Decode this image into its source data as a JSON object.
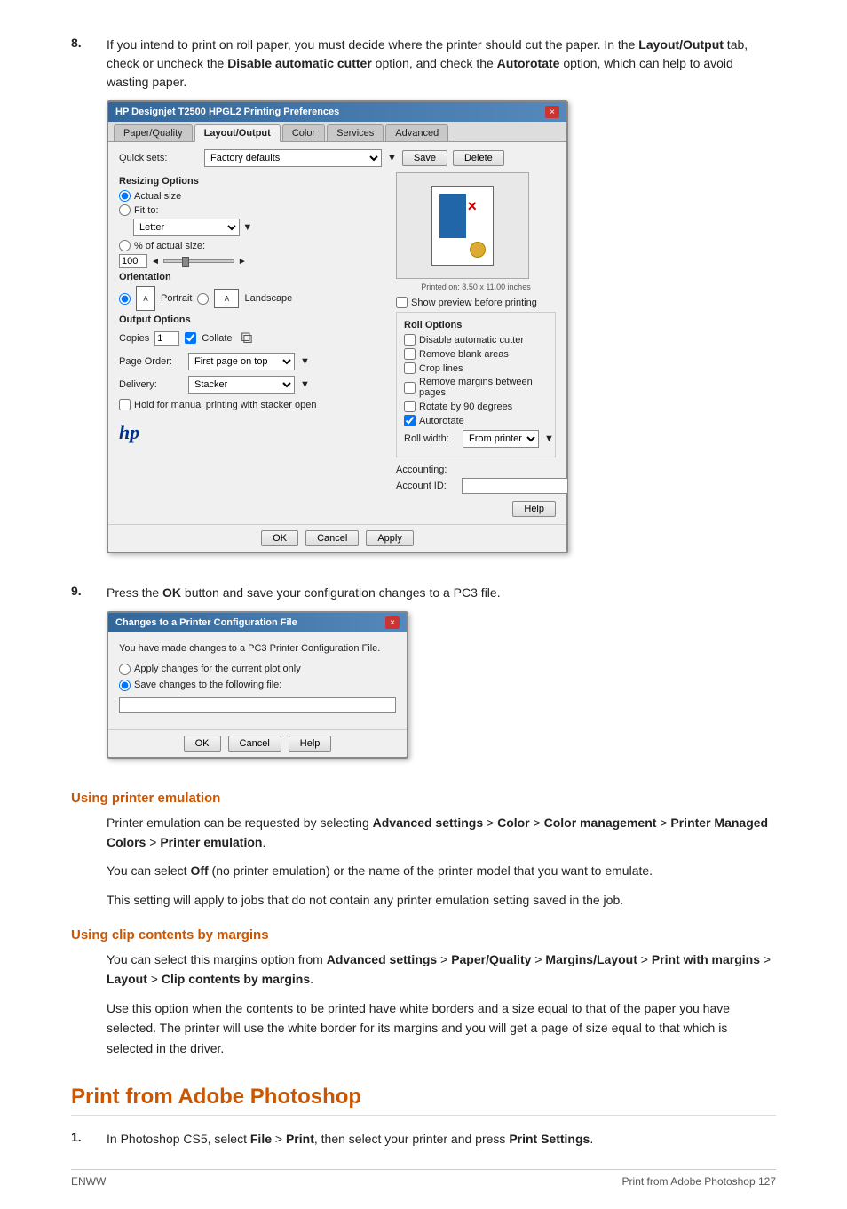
{
  "page": {
    "footer_left": "ENWW",
    "footer_right": "Print from Adobe Photoshop   127"
  },
  "step8": {
    "number": "8.",
    "text_intro": "If you intend to print on roll paper, you must decide where the printer should cut the paper. In the ",
    "bold1": "Layout/Output",
    "text_mid": " tab, check or uncheck the ",
    "bold2": "Disable automatic cutter",
    "text_mid2": " option, and check the ",
    "bold3": "Autorotate",
    "text_end": " option, which can help to avoid wasting paper."
  },
  "dialog1": {
    "title": "HP Designjet T2500 HPGL2 Printing Preferences",
    "close_btn": "×",
    "tabs": [
      "Paper/Quality",
      "Layout/Output",
      "Color",
      "Services",
      "Advanced"
    ],
    "active_tab": "Layout/Output",
    "quick_sets_label": "Quick sets:",
    "factory_defaults": "Factory defaults",
    "save_btn": "Save",
    "delete_btn": "Delete",
    "resizing_options": "Resizing Options",
    "actual_size": "Actual size",
    "fit_to": "Fit to:",
    "fit_to_value": "Letter",
    "pct_actual": "% of actual size:",
    "pct_value": "100",
    "orientation_label": "Orientation",
    "portrait": "Portrait",
    "landscape": "Landscape",
    "output_options": "Output Options",
    "copies_label": "Copies",
    "copies_value": "1",
    "collate": "Collate",
    "page_order_label": "Page Order:",
    "page_order_value": "First page on top",
    "delivery_label": "Delivery:",
    "delivery_value": "Stacker",
    "hold_label": "Hold for manual printing with stacker open",
    "hp_logo": "hp",
    "help_btn": "Help",
    "ok_btn": "OK",
    "cancel_btn": "Cancel",
    "apply_btn": "Apply",
    "preview_text": "Printed on: 8.50 x 11.00 inches",
    "show_preview": "Show preview before printing",
    "roll_options_label": "Roll Options",
    "disable_auto_cutter": "Disable automatic cutter",
    "remove_blank_areas": "Remove blank areas",
    "crop_lines": "Crop lines",
    "remove_margins": "Remove margins between pages",
    "rotate_90": "Rotate by 90 degrees",
    "autorotate": "Autorotate",
    "roll_width_label": "Roll width:",
    "roll_width_value": "From printer",
    "accounting_label": "Accounting:",
    "account_id_label": "Account ID:"
  },
  "step9": {
    "number": "9.",
    "text": "Press the ",
    "bold_ok": "OK",
    "text2": " button and save your configuration changes to a PC3 file."
  },
  "dialog2": {
    "title": "Changes to a Printer Configuration File",
    "close_btn": "×",
    "body_text": "You have made changes to a PC3 Printer Configuration File.",
    "radio1": "Apply changes for the current plot only",
    "radio2": "Save changes to the following file:",
    "ok_btn": "OK",
    "cancel_btn": "Cancel",
    "help_btn": "Help"
  },
  "section_printer_emulation": {
    "heading": "Using printer emulation",
    "para1_start": "Printer emulation can be requested by selecting ",
    "bold1": "Advanced settings",
    "gt1": " > ",
    "bold2": "Color",
    "gt2": " > ",
    "bold3": "Color management",
    "gt3": " > ",
    "bold4": "Printer Managed Colors",
    "gt4": " > ",
    "bold5": "Printer emulation",
    "para1_end": ".",
    "para2_start": "You can select ",
    "bold_off": "Off",
    "para2_end": " (no printer emulation) or the name of the printer model that you want to emulate.",
    "para3": "This setting will apply to jobs that do not contain any printer emulation setting saved in the job."
  },
  "section_clip_contents": {
    "heading": "Using clip contents by margins",
    "para1_start": "You can select this margins option from ",
    "bold1": "Advanced settings",
    "gt1": " > ",
    "bold2": "Paper/Quality",
    "gt2": " > ",
    "bold3": "Margins/Layout",
    "gt3": " > ",
    "bold4": "Print with margins",
    "gt4": " > ",
    "bold5": "Layout",
    "gt5": " > ",
    "bold6": "Clip contents by margins",
    "para1_end": ".",
    "para2": "Use this option when the contents to be printed have white borders and a size equal to that of the paper you have selected. The printer will use the white border for its margins and you will get a page of size equal to that which is selected in the driver."
  },
  "section_photoshop": {
    "heading": "Print from Adobe Photoshop",
    "step1_number": "1.",
    "step1_start": "In Photoshop CS5, select ",
    "step1_bold1": "File",
    "step1_gt1": " > ",
    "step1_bold2": "Print",
    "step1_mid": ", then select your printer and press ",
    "step1_bold3": "Print Settings",
    "step1_end": "."
  }
}
